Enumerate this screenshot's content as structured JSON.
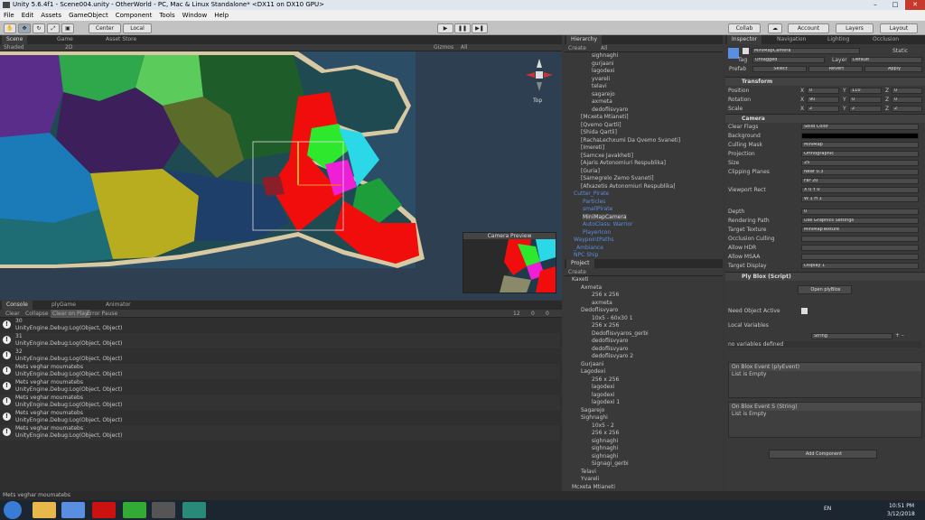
{
  "window": {
    "title": "Unity 5.6.4f1 - Scene004.unity - OtherWorld - PC, Mac & Linux Standalone* <DX11 on DX10 GPU>"
  },
  "menu": [
    "File",
    "Edit",
    "Assets",
    "GameObject",
    "Component",
    "Tools",
    "Window",
    "Help"
  ],
  "toolbar": {
    "center": "Center",
    "local": "Local",
    "collab": "Collab",
    "account": "Account",
    "layers": "Layers",
    "layout": "Layout"
  },
  "scene": {
    "tabs": [
      "Scene",
      "Game",
      "Asset Store"
    ],
    "shading": "Shaded",
    "mode2d": "2D",
    "gizmos": "Gizmos",
    "search": "All",
    "persp": "Top",
    "camera_preview": "Camera Preview"
  },
  "console": {
    "tabs": [
      "Console",
      "plyGame",
      "Animator"
    ],
    "buttons": [
      "Clear",
      "Collapse",
      "Clear on Play",
      "Error Pause"
    ],
    "counts": [
      "12",
      "0",
      "0"
    ],
    "rows": [
      {
        "l1": "30",
        "l2": "UnityEngine.Debug:Log(Object, Object)"
      },
      {
        "l1": "31",
        "l2": "UnityEngine.Debug:Log(Object, Object)"
      },
      {
        "l1": "32",
        "l2": "UnityEngine.Debug:Log(Object, Object)"
      },
      {
        "l1": "Mets veghar moumatebs",
        "l2": "UnityEngine.Debug:Log(Object, Object)"
      },
      {
        "l1": "Mets veghar moumatebs",
        "l2": "UnityEngine.Debug:Log(Object, Object)"
      },
      {
        "l1": "Mets veghar moumatebs",
        "l2": "UnityEngine.Debug:Log(Object, Object)"
      },
      {
        "l1": "Mets veghar moumatebs",
        "l2": "UnityEngine.Debug:Log(Object, Object)"
      },
      {
        "l1": "Mets veghar moumatebs",
        "l2": "UnityEngine.Debug:Log(Object, Object)"
      }
    ]
  },
  "hierarchy": {
    "title": "Hierarchy",
    "create": "Create",
    "search": "All",
    "items": [
      "sighnaghi",
      "gurjaani",
      "lagodexi",
      "yvareli",
      "telavi",
      "sagarejo",
      "axmeta",
      "dedoflisvyaro",
      "[Mcxeta Mtianeti]",
      "[Qvemo Qartli]",
      "[Shida Qartli]",
      "[RachaLechxumi Da Qvemo Svaneti]",
      "[Imereti]",
      "[Samcxe Javakheti]",
      "[Ajaris Avtonomiuri Respublika]",
      "[Guria]",
      "[Samegrelo Zemo Svaneti]",
      "[Afxazetis Avtonomiuri Respublika]",
      "Cutter_Pirate",
      "Particles",
      "smallPirate",
      "MiniMapCamera",
      "AutoClass: Warrior",
      "PlayerIcon",
      "WaypointPaths",
      "_Ambiance",
      "NPC Ship"
    ]
  },
  "project": {
    "title": "Project",
    "create": "Create",
    "items": [
      "Kaxeti",
      "Axmeta",
      "256 x 256",
      "axmeta",
      "Dedoflisvyaro",
      "10x5 - 60x30 1",
      "256 x 256",
      "Dedoflisvyaros_gerbi",
      "dedoflisvyaro",
      "dedoflisvyaro",
      "dedoflisvyaro 2",
      "Gurjaani",
      "Lagodexi",
      "256 x 256",
      "lagodexi",
      "lagodexi",
      "lagodexi 1",
      "Sagarejo",
      "Sighnaghi",
      "10x5 - 2",
      "256 x 256",
      "sighnaghi",
      "sighnaghi",
      "sighnaghi",
      "Signagi_gerbi",
      "Telavi",
      "Yvareli",
      "Mcxeta Mtianeti"
    ]
  },
  "inspector": {
    "tabs": [
      "Inspector",
      "Navigation",
      "Lighting",
      "Occlusion"
    ],
    "object_name": "MiniMapCamera",
    "static": "Static",
    "tag_label": "Tag",
    "tag": "Untagged",
    "layer_label": "Layer",
    "layer": "Default",
    "prefab_label": "Prefab",
    "prefab_buttons": [
      "Select",
      "Revert",
      "Apply"
    ],
    "transform": {
      "title": "Transform",
      "position": {
        "label": "Position",
        "x": "0",
        "y": "110",
        "z": "0"
      },
      "rotation": {
        "label": "Rotation",
        "x": "90",
        "y": "0",
        "z": "0"
      },
      "scale": {
        "label": "Scale",
        "x": "2",
        "y": "2",
        "z": "2"
      }
    },
    "camera": {
      "title": "Camera",
      "fields": [
        {
          "label": "Clear Flags",
          "value": "Solid Color"
        },
        {
          "label": "Background",
          "value": ""
        },
        {
          "label": "Culling Mask",
          "value": "MiniMap"
        },
        {
          "label": "Projection",
          "value": "Orthographic"
        },
        {
          "label": "Size",
          "value": "25"
        },
        {
          "label": "Clipping Planes",
          "value": "Near  0.3"
        },
        {
          "label": "",
          "value": "Far   20"
        },
        {
          "label": "Viewport Rect",
          "value": "X 0       Y 0"
        },
        {
          "label": "",
          "value": "W 1       H 1"
        },
        {
          "label": "Depth",
          "value": "0"
        },
        {
          "label": "Rendering Path",
          "value": "Use Graphics Settings"
        },
        {
          "label": "Target Texture",
          "value": "MiniMapTexture"
        },
        {
          "label": "Occlusion Culling",
          "value": ""
        },
        {
          "label": "Allow HDR",
          "value": ""
        },
        {
          "label": "Allow MSAA",
          "value": ""
        },
        {
          "label": "Target Display",
          "value": "Display 1"
        }
      ]
    },
    "plyblox": {
      "title": "Ply Blox (Script)",
      "open_button": "Open plyBlox",
      "need_active": "Need Object Active",
      "local_vars": "Local Variables",
      "var_type": "String",
      "no_vars": "no variables defined",
      "event1_title": "On Blox Event (plyEvent)",
      "event1_body": "List is Empty",
      "event2_title": "On Blox Event S (String)",
      "event2_body": "List is Empty"
    },
    "add_component": "Add Component"
  },
  "status": {
    "message": "Mets veghar moumatebs"
  },
  "taskbar": {
    "lang": "EN",
    "time": "10:51 PM",
    "date": "3/12/2018"
  },
  "colors": {
    "accent": "#3d6eb5",
    "panel": "#393939",
    "map_red": "#f20d0d"
  }
}
